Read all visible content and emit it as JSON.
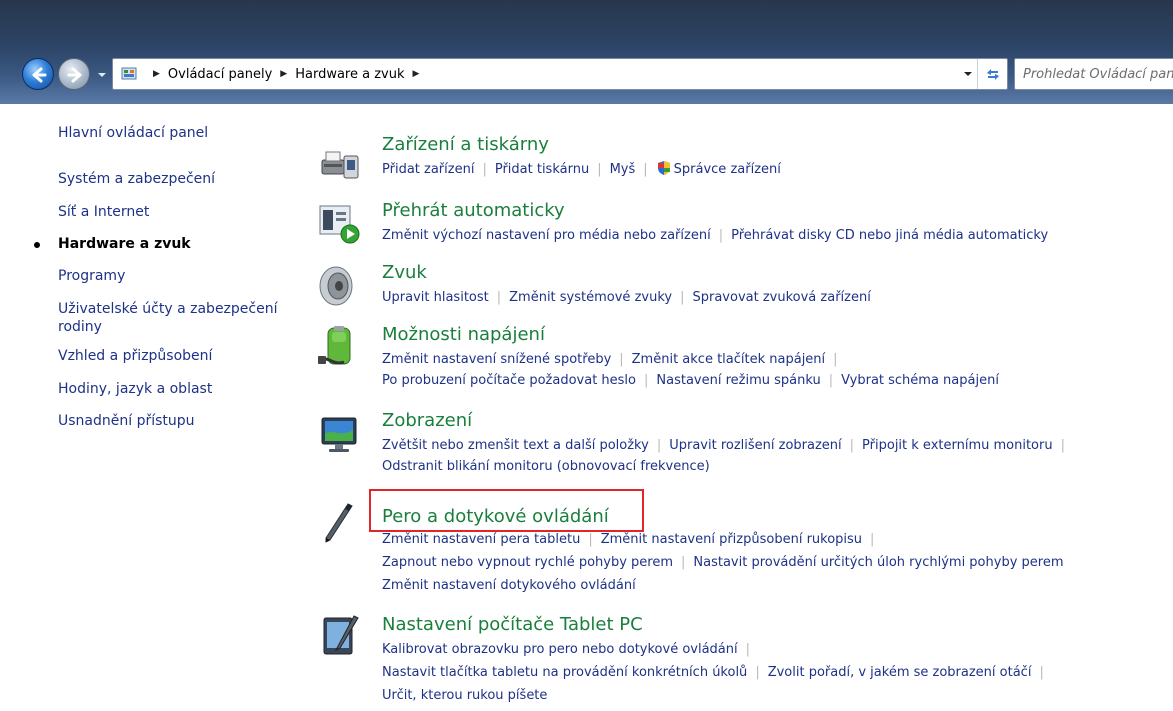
{
  "breadcrumb": [
    "Ovládací panely",
    "Hardware a zvuk"
  ],
  "search": {
    "placeholder": "Prohledat Ovládací panely"
  },
  "sidebar": {
    "items": [
      {
        "label": "Hlavní ovládací panel"
      },
      {
        "label": "Systém a zabezpečení"
      },
      {
        "label": "Síť a Internet"
      },
      {
        "label": "Hardware a zvuk"
      },
      {
        "label": "Programy"
      },
      {
        "label": "Uživatelské účty a zabezpečení"
      },
      {
        "label": "rodiny"
      },
      {
        "label": "Vzhled a přizpůsobení"
      },
      {
        "label": "Hodiny, jazyk a oblast"
      },
      {
        "label": "Usnadnění přístupu"
      }
    ]
  },
  "categories": [
    {
      "title": "Zařízení a tiskárny",
      "icon": "devices-printers-icon",
      "links": [
        [
          "Přidat zařízení",
          "Přidat tiskárnu",
          "Myš",
          "Správce zařízení"
        ]
      ]
    },
    {
      "title": "Přehrát automaticky",
      "icon": "autoplay-icon",
      "links": [
        [
          "Změnit výchozí nastavení pro média nebo zařízení",
          "Přehrávat disky CD nebo jiná média automaticky"
        ]
      ]
    },
    {
      "title": "Zvuk",
      "icon": "speaker-icon",
      "links": [
        [
          "Upravit hlasitost",
          "Změnit systémové zvuky",
          "Spravovat zvuková zařízení"
        ]
      ]
    },
    {
      "title": "Možnosti napájení",
      "icon": "battery-icon",
      "links": [
        [
          "Změnit nastavení snížené spotřeby",
          "Změnit akce tlačítek napájení"
        ],
        [
          "Po probuzení počítače požadovat heslo",
          "Nastavení režimu spánku",
          "Vybrat schéma napájení"
        ]
      ]
    },
    {
      "title": "Zobrazení",
      "icon": "monitor-icon",
      "links": [
        [
          "Zvětšit nebo zmenšit text a další položky",
          "Upravit rozlišení zobrazení",
          "Připojit k externímu monitoru"
        ],
        [
          "Odstranit blikání monitoru (obnovovací frekvence)"
        ]
      ]
    },
    {
      "title": "Pero a dotykové ovládání",
      "icon": "pen-icon",
      "links": [
        [
          "Změnit nastavení pera tabletu",
          "Změnit nastavení přizpůsobení rukopisu"
        ],
        [
          "Zapnout nebo vypnout rychlé pohyby perem",
          "Nastavit provádění určitých úloh rychlými pohyby perem"
        ],
        [
          "Změnit nastavení dotykového ovládání"
        ]
      ]
    },
    {
      "title": "Nastavení počítače Tablet PC",
      "icon": "tablet-pc-icon",
      "links": [
        [
          "Kalibrovat obrazovku pro pero nebo dotykové ovládání"
        ],
        [
          "Nastavit tlačítka tabletu na provádění konkrétních úkolů",
          "Zvolit pořadí, v jakém se zobrazení otáčí"
        ],
        [
          "Určit, kterou rukou píšete"
        ]
      ]
    }
  ],
  "colors": {
    "link": "#1e3287",
    "category_title": "#1a7f3c",
    "highlight": "#e0262a"
  }
}
